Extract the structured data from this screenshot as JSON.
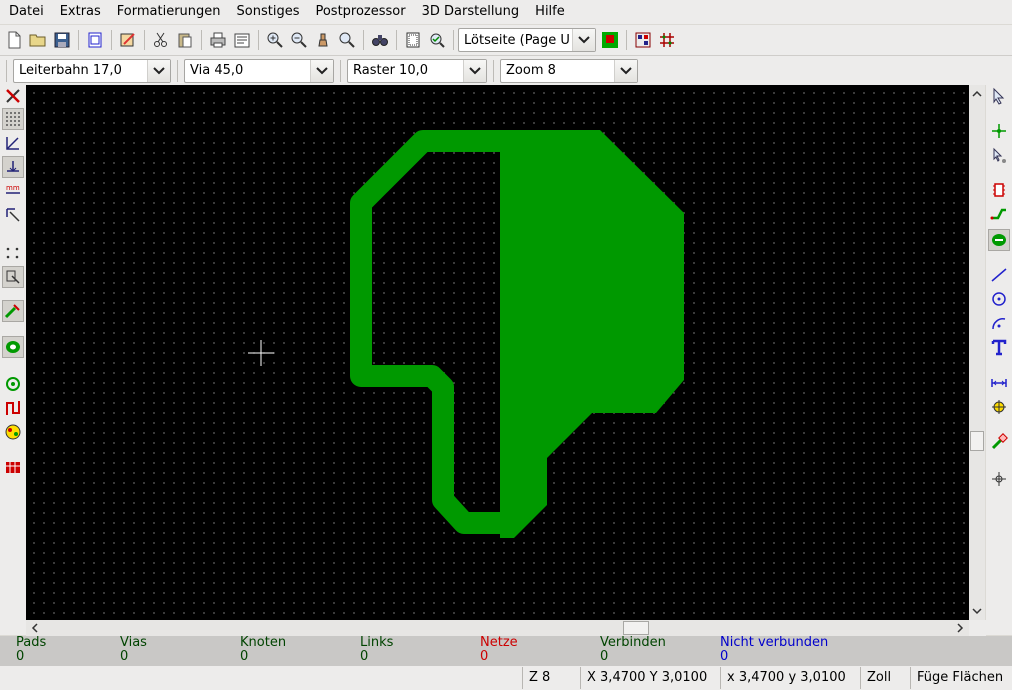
{
  "menu": [
    "Datei",
    "Extras",
    "Formatierungen",
    "Sonstiges",
    "Postprozessor",
    "3D Darstellung",
    "Hilfe"
  ],
  "toolbar": {
    "layer_select": "Lötseite  (Page U"
  },
  "options": {
    "track_width": "Leiterbahn 17,0",
    "via_size": "Via 45,0",
    "grid": "Raster 10,0",
    "zoom": "Zoom 8"
  },
  "info": {
    "pads_label": "Pads",
    "pads_value": "0",
    "vias_label": "Vias",
    "vias_value": "0",
    "nodes_label": "Knoten",
    "nodes_value": "0",
    "links_label": "Links",
    "links_value": "0",
    "nets_label": "Netze",
    "nets_value": "0",
    "connected_label": "Verbinden",
    "connected_value": "0",
    "unconnected_label": "Nicht verbunden",
    "unconnected_value": "0"
  },
  "status": {
    "zoom": "Z 8",
    "abs_coords": "X 3,4700  Y 3,0100",
    "rel_coords": "x 3,4700  y 3,0100",
    "units": "Zoll",
    "mode": "Füge Flächen"
  },
  "colors": {
    "copper": "#009900",
    "canvas_bg": "#000000",
    "pads": "#004400",
    "nets": "#cc0000",
    "unconnected": "#0000cc"
  },
  "icons": {
    "file": [
      "new-file-icon",
      "open-file-icon",
      "save-icon",
      "page-settings-icon",
      "load-module-icon",
      "cut-icon",
      "paste-icon",
      "print-icon",
      "plot-icon",
      "zoom-in-icon",
      "zoom-out-icon",
      "redraw-icon",
      "zoom-fit-icon",
      "find-icon",
      "netlist-icon",
      "drc-icon",
      "layer-color-icon",
      "auto-place-icon",
      "auto-route-icon"
    ]
  }
}
